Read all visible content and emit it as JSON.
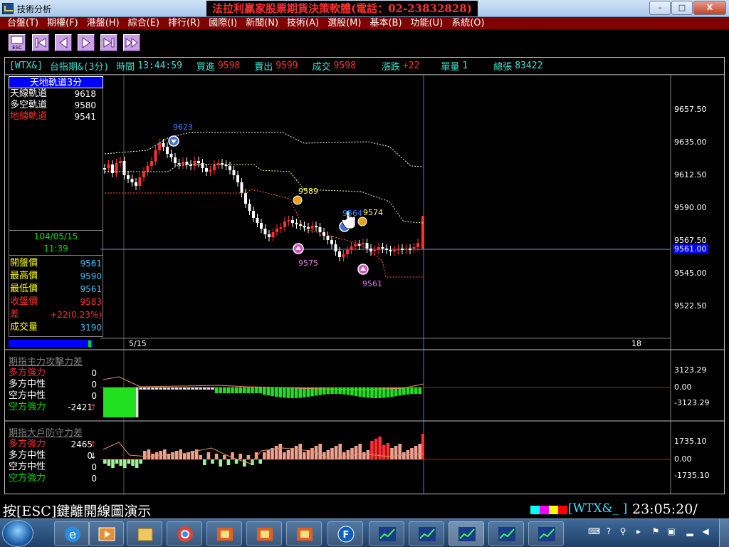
{
  "window": {
    "title": "技術分析",
    "banner": "法拉利贏家股票期貨決策軟體(電話：02-23832828)",
    "buttons": {
      "minimize": "–",
      "maximize": "□",
      "close": "X"
    }
  },
  "menu": [
    {
      "label": "台盤(T)"
    },
    {
      "label": "期權(F)"
    },
    {
      "label": "港盤(H)"
    },
    {
      "label": "綜合(E)"
    },
    {
      "label": "排行(R)"
    },
    {
      "label": "國際(I)"
    },
    {
      "label": "新聞(N)"
    },
    {
      "label": "技術(A)"
    },
    {
      "label": "選股(M)"
    },
    {
      "label": "基本(B)"
    },
    {
      "label": "功能(U)"
    },
    {
      "label": "系統(O)"
    }
  ],
  "toolbar": {
    "esc_label": "ESC"
  },
  "infobar": {
    "symbol": "[WTX&]",
    "name": "台指期&(3分)",
    "time_label": "時間",
    "time": "13:44:59",
    "bid_label": "買進",
    "bid": "9598",
    "ask_label": "賣出",
    "ask": "9599",
    "deal_label": "成交",
    "deal": "9598",
    "change_label": "漲跌",
    "change": "+22",
    "vol_label": "單量",
    "vol": "1",
    "total_label": "總張",
    "total": "83422"
  },
  "indicator": {
    "title": "天地軌道3分",
    "rows": [
      {
        "label": "天線軌道",
        "value": "9618",
        "color": "#ffffff"
      },
      {
        "label": "多空軌道",
        "value": "9580",
        "color": "#ffffff"
      },
      {
        "label": "地線軌道",
        "value": "9541",
        "color": "#ff3030"
      }
    ]
  },
  "cursor_info": {
    "date": "104/05/15",
    "time": "11:39",
    "rows": [
      {
        "label": "開盤價",
        "value": "9561",
        "lcolor": "#ffff00",
        "vcolor": "#40c0ff"
      },
      {
        "label": "最高價",
        "value": "9590",
        "lcolor": "#ffff00",
        "vcolor": "#40c0ff"
      },
      {
        "label": "最低價",
        "value": "9561",
        "lcolor": "#ffff00",
        "vcolor": "#40c0ff"
      },
      {
        "label": "收盤價",
        "value": "9583",
        "lcolor": "#ff3030",
        "vcolor": "#ff3030"
      },
      {
        "label": "差",
        "value": "+22(0.23%)",
        "lcolor": "#ff3030",
        "vcolor": "#ff3030"
      },
      {
        "label": "成交量",
        "value": "3190",
        "lcolor": "#ffff00",
        "vcolor": "#40c0ff"
      }
    ]
  },
  "price_axis": {
    "ticks": [
      "9657.50",
      "9635.00",
      "9612.50",
      "9590.00",
      "9567.50",
      "9545.00",
      "9522.50"
    ],
    "current": "9561.00",
    "date_labels": [
      "5/15",
      "18"
    ]
  },
  "chart_data": {
    "type": "candlestick",
    "annotations": [
      {
        "label": "9623",
        "color": "#4080ff"
      },
      {
        "label": "9589",
        "color": "#ffff60"
      },
      {
        "label": "9564",
        "color": "#4080ff"
      },
      {
        "label": "9574",
        "color": "#ffff60"
      },
      {
        "label": "9575",
        "color": "#e080e0"
      },
      {
        "label": "9561",
        "color": "#e080e0"
      }
    ]
  },
  "sub1": {
    "title": "期指主力攻擊力差",
    "rows": [
      {
        "label": "多方強力",
        "value": "0",
        "color": "#ff3030",
        "arrow": ""
      },
      {
        "label": "多方中性",
        "value": "0",
        "color": "#ffffff",
        "arrow": ""
      },
      {
        "label": "空方中性",
        "value": "0",
        "color": "#ffffff",
        "arrow": ""
      },
      {
        "label": "空方強力",
        "value": "-2421",
        "color": "#00e000",
        "arrow": "↑"
      }
    ],
    "axis": [
      "3123.29",
      "0.00",
      "-3123.29"
    ]
  },
  "sub2": {
    "title": "期指大戶防守力差",
    "rows": [
      {
        "label": "多方強力",
        "value": "2465",
        "color": "#ff3030",
        "arrow": "↑"
      },
      {
        "label": "多方中性",
        "value": "0",
        "color": "#ffffff",
        "arrow": "↓"
      },
      {
        "label": "空方中性",
        "value": "0",
        "color": "#ffffff",
        "arrow": ""
      },
      {
        "label": "空方強力",
        "value": "0",
        "color": "#00e000",
        "arrow": ""
      }
    ],
    "axis": [
      "1735.10",
      "0.00",
      "-1735.10"
    ]
  },
  "status": {
    "text": "按[ESC]鍵離開線圖演示",
    "code": "[WTX&_ ]",
    "time": "23:05:20/"
  }
}
